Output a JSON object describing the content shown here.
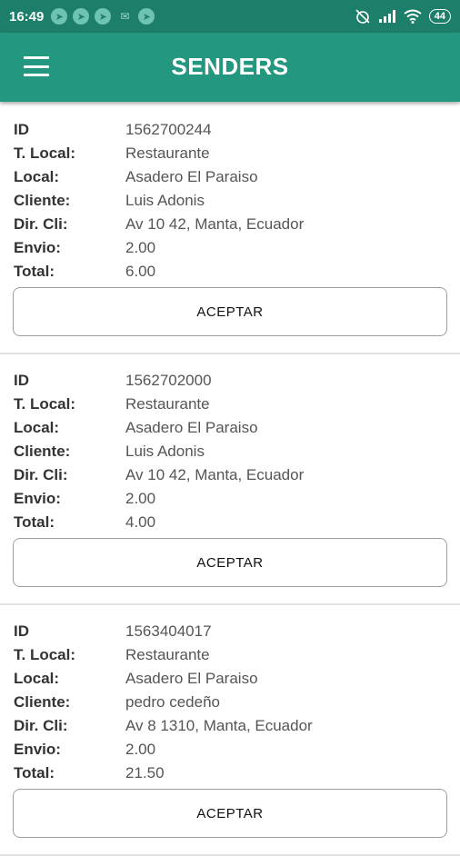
{
  "status_bar": {
    "time": "16:49",
    "notifications": [
      "app-notification-icon",
      "app-notification-icon",
      "app-notification-icon",
      "mail-icon",
      "app-notification-icon"
    ],
    "battery_level": "44"
  },
  "app_bar": {
    "title": "SENDERS"
  },
  "labels": {
    "id": "ID",
    "local_type": "T. Local:",
    "local": "Local:",
    "client": "Cliente:",
    "client_address": "Dir. Cli:",
    "shipping": "Envio:",
    "total": "Total:"
  },
  "orders": [
    {
      "id": "1562700244",
      "local_type": "Restaurante",
      "local": "Asadero El Paraiso",
      "client": "Luis Adonis",
      "client_address": "Av 10 42, Manta, Ecuador",
      "shipping": "2.00",
      "total": "6.00",
      "action_label": "ACEPTAR"
    },
    {
      "id": "1562702000",
      "local_type": "Restaurante",
      "local": "Asadero El Paraiso",
      "client": "Luis Adonis",
      "client_address": "Av 10 42, Manta, Ecuador",
      "shipping": "2.00",
      "total": "4.00",
      "action_label": "ACEPTAR"
    },
    {
      "id": "1563404017",
      "local_type": "Restaurante",
      "local": "Asadero El Paraiso",
      "client": "pedro cedeño",
      "client_address": "Av 8 1310, Manta, Ecuador",
      "shipping": "2.00",
      "total": "21.50",
      "action_label": "ACEPTAR"
    }
  ],
  "colors": {
    "status_bar": "#1d7f6a",
    "app_bar": "#23977f"
  }
}
